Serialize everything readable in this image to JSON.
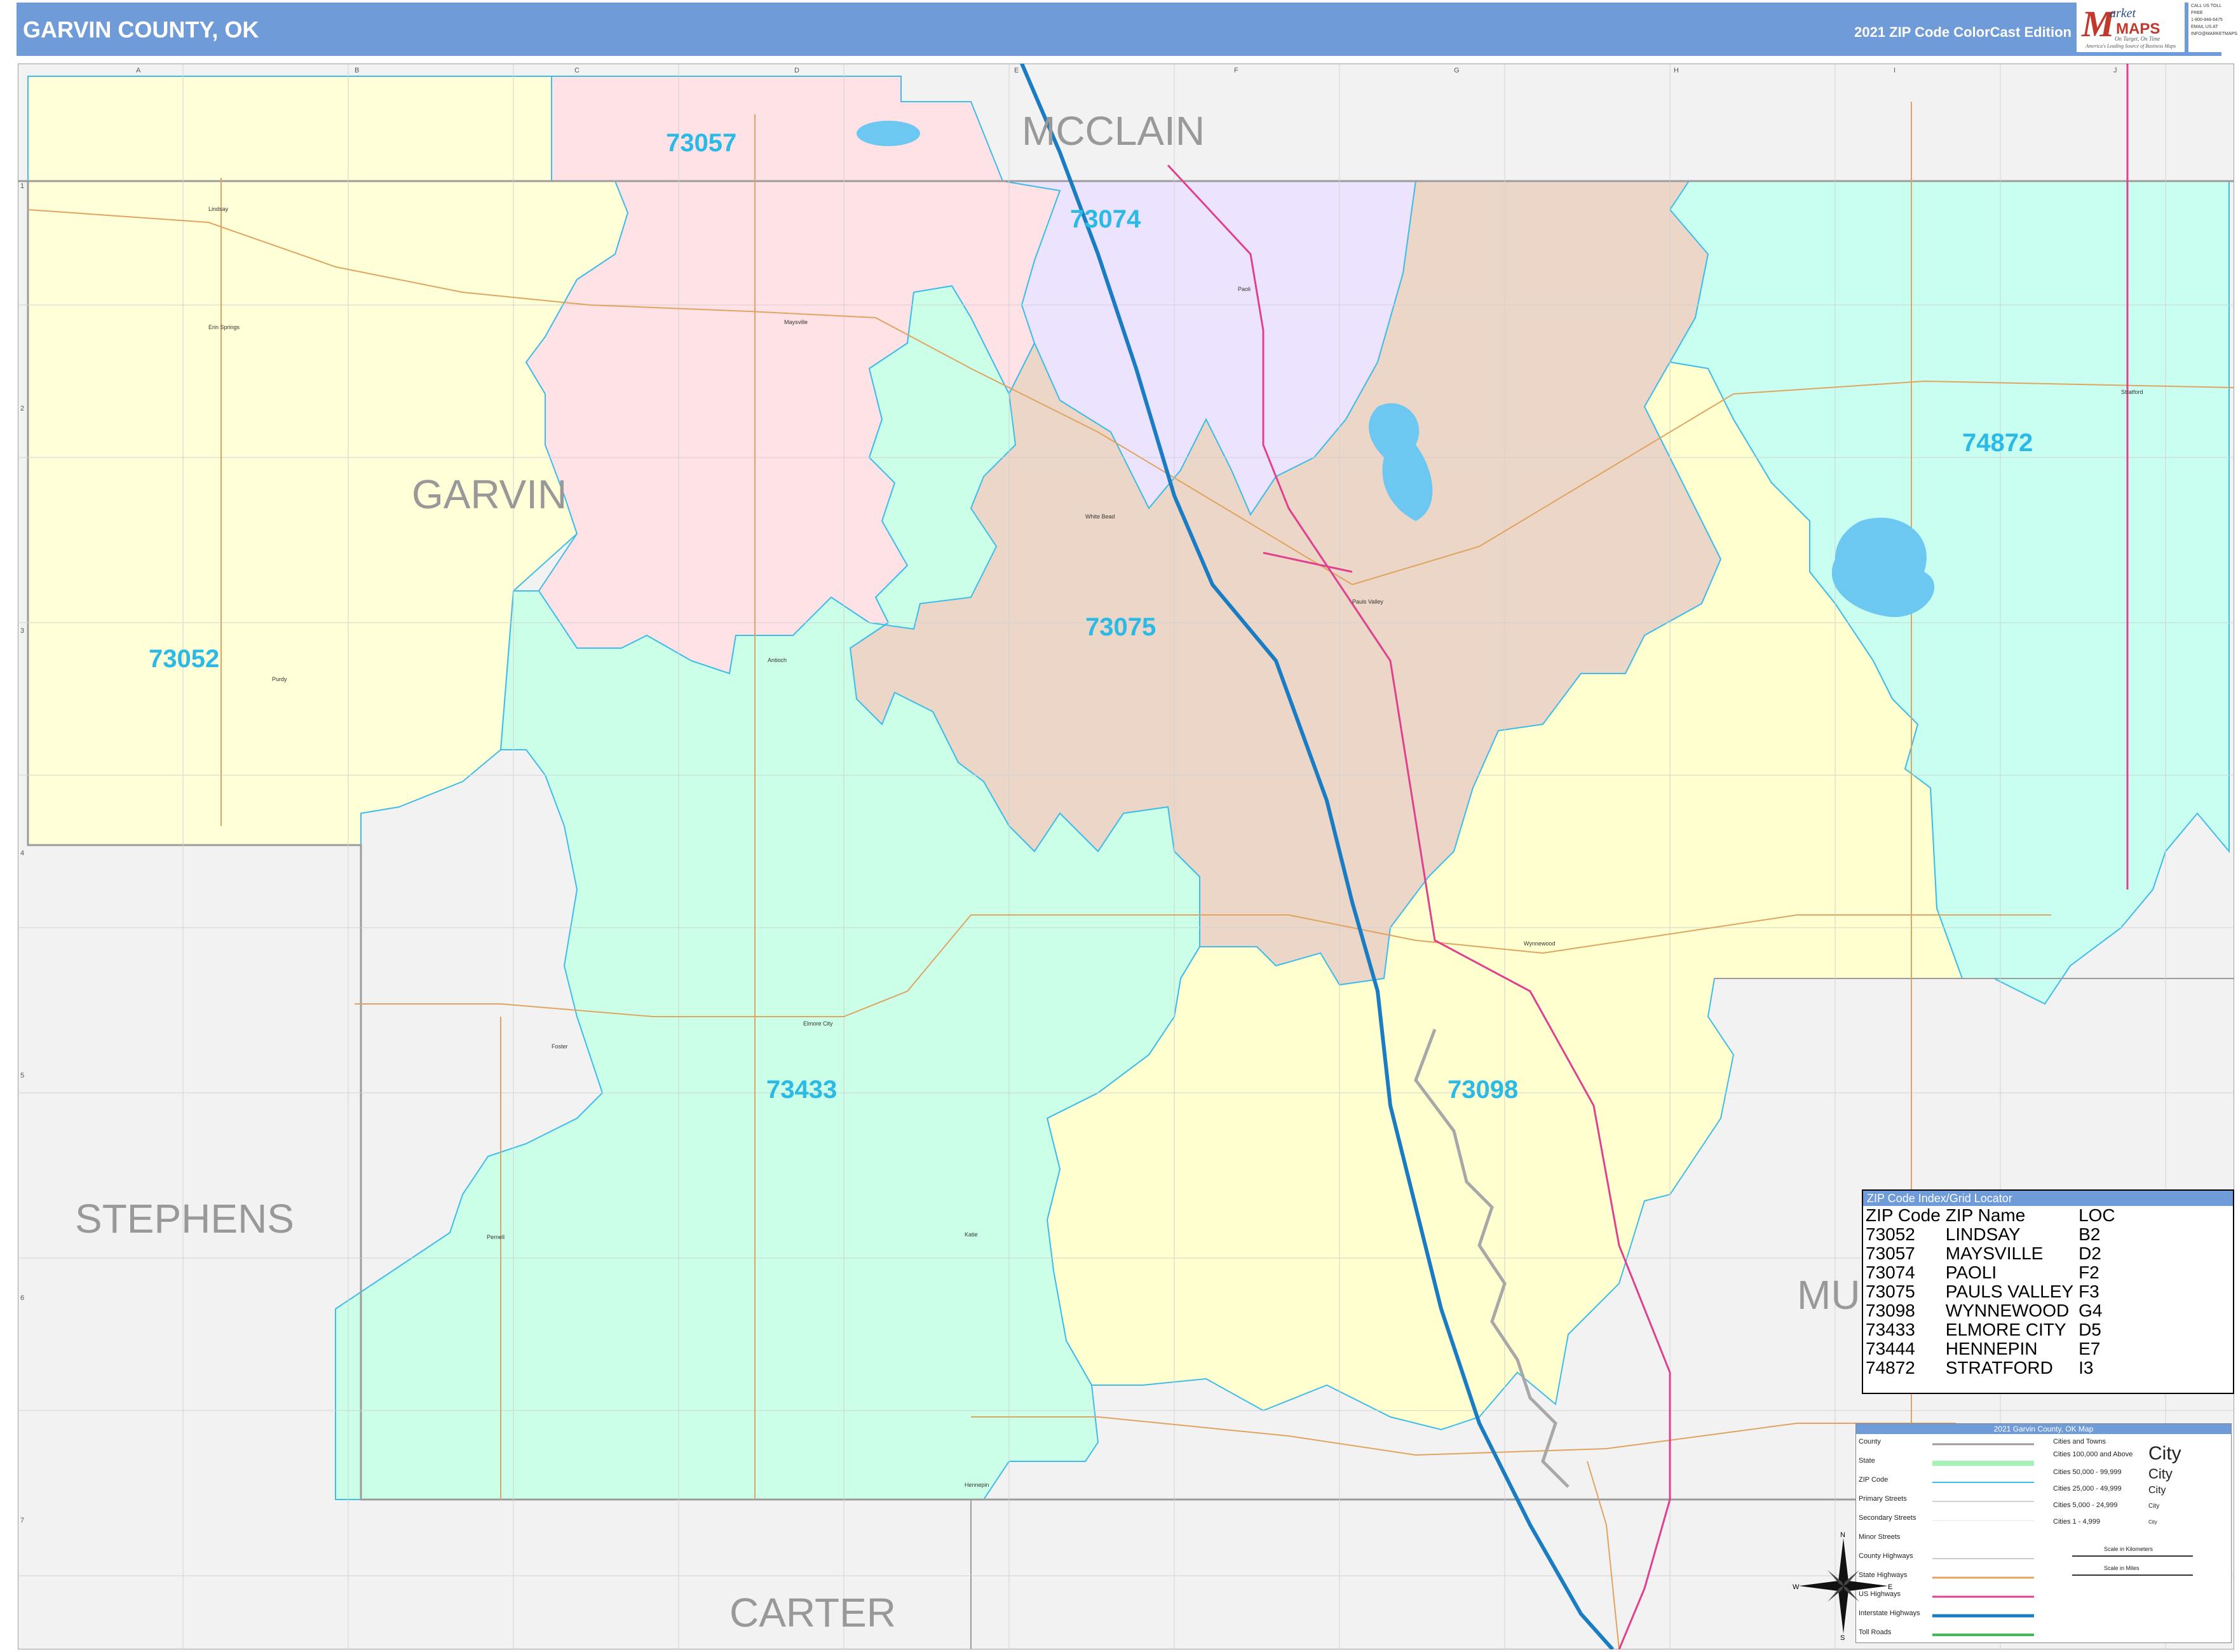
{
  "header": {
    "title": "GARVIN COUNTY, OK",
    "edition": "2021 ZIP Code ColorCast Edition",
    "logo_brand_m": "M",
    "logo_brand_arket": "arket",
    "logo_brand_maps": "MAPS",
    "logo_tagline": "On Target, On Time",
    "logo_tagline2": "America's Leading Source of Business Maps",
    "contact": [
      "CALL US TOLL FREE",
      "1-800-848-6475",
      "",
      "EMAIL US AT",
      "INFO@MARKETMAPS.COM"
    ],
    "bg_color": "#6f9bd8"
  },
  "map": {
    "county_labels": [
      "MCCLAIN",
      "GARVIN",
      "STEPHENS",
      "CARTER",
      "MU"
    ],
    "zip_labels": [
      "73057",
      "73074",
      "74872",
      "73052",
      "73075",
      "73433",
      "73098"
    ],
    "city_labels": [
      "Lindsay",
      "Maysville",
      "Paoli",
      "Elmore City",
      "Pauls Valley",
      "Wynnewood",
      "Stratford",
      "Hennepin",
      "Foster",
      "Katie",
      "Pernell",
      "Purdy",
      "Antioch",
      "White Bead",
      "Erin Springs"
    ],
    "grid_columns": [
      "A",
      "B",
      "C",
      "D",
      "E",
      "F",
      "G",
      "H",
      "I",
      "J"
    ],
    "grid_rows": [
      "1",
      "2",
      "3",
      "4",
      "5",
      "6",
      "7"
    ],
    "zip_colors": {
      "73052": "#ffffd8",
      "73057": "#ffe2e6",
      "73074": "#ece4ff",
      "73075": "#ebd6c8",
      "73433": "#cbffe8",
      "73098": "#ffffd0",
      "74872": "#c8fff0",
      "outside": "#f2f2f2"
    }
  },
  "index": {
    "title": "ZIP Code Index/Grid Locator",
    "headers": [
      "ZIP Code",
      "ZIP Name",
      "LOC"
    ],
    "rows": [
      [
        "73052",
        "LINDSAY",
        "B2"
      ],
      [
        "73057",
        "MAYSVILLE",
        "D2"
      ],
      [
        "73074",
        "PAOLI",
        "F2"
      ],
      [
        "73075",
        "PAULS VALLEY",
        "F3"
      ],
      [
        "73098",
        "WYNNEWOOD",
        "G4"
      ],
      [
        "73433",
        "ELMORE CITY",
        "D5"
      ],
      [
        "73444",
        "HENNEPIN",
        "E7"
      ],
      [
        "74872",
        "STRATFORD",
        "I3"
      ]
    ]
  },
  "legend": {
    "title": "2021 Garvin County, OK Map",
    "left_items": [
      "County",
      "State",
      "ZIP Code",
      "Primary Streets",
      "Secondary Streets",
      "Minor Streets",
      "County Highways",
      "State Highways",
      "US Highways",
      "Interstate Highways",
      "Toll Roads"
    ],
    "city_header": "Cities and Towns",
    "city_items": [
      "Cities 100,000 and Above",
      "Cities 50,000 - 99,999",
      "Cities 25,000 - 49,999",
      "Cities 5,000 - 24,999",
      "Cities 1 - 4,999"
    ],
    "city_samples": [
      "City",
      "City",
      "City",
      "City",
      "City"
    ],
    "scale_km": "Scale in Kilometers",
    "scale_mi": "Scale in Miles",
    "compass": [
      "N",
      "S",
      "E",
      "W"
    ]
  }
}
